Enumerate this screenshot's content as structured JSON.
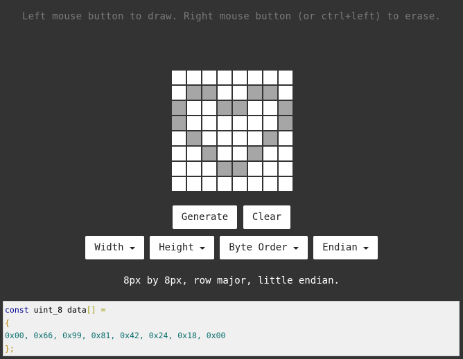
{
  "hint": "Left mouse button to draw. Right mouse button (or ctrl+left) to erase.",
  "grid": {
    "rows": 8,
    "cols": 8,
    "pixels": [
      [
        0,
        0,
        0,
        0,
        0,
        0,
        0,
        0
      ],
      [
        0,
        1,
        1,
        0,
        0,
        1,
        1,
        0
      ],
      [
        1,
        0,
        0,
        1,
        1,
        0,
        0,
        1
      ],
      [
        1,
        0,
        0,
        0,
        0,
        0,
        0,
        1
      ],
      [
        0,
        1,
        0,
        0,
        0,
        0,
        1,
        0
      ],
      [
        0,
        0,
        1,
        0,
        0,
        1,
        0,
        0
      ],
      [
        0,
        0,
        0,
        1,
        1,
        0,
        0,
        0
      ],
      [
        0,
        0,
        0,
        0,
        0,
        0,
        0,
        0
      ]
    ],
    "on_color": "#a6a6a6",
    "off_color": "#ffffff"
  },
  "buttons": {
    "generate": "Generate",
    "clear": "Clear"
  },
  "dropdowns": {
    "width": "Width",
    "height": "Height",
    "byte_order": "Byte Order",
    "endian": "Endian"
  },
  "summary": "8px by 8px, row major, little endian.",
  "code": {
    "keyword": "const",
    "type": "uint_8",
    "name": "data",
    "brackets": "[]",
    "assign": "=",
    "open_brace": "{",
    "values": "0x00, 0x66, 0x99, 0x81, 0x42, 0x24, 0x18, 0x00",
    "close": "};"
  },
  "colors": {
    "background": "#333333",
    "button_bg": "#ffffff",
    "code_bg": "#f0f0f0"
  }
}
